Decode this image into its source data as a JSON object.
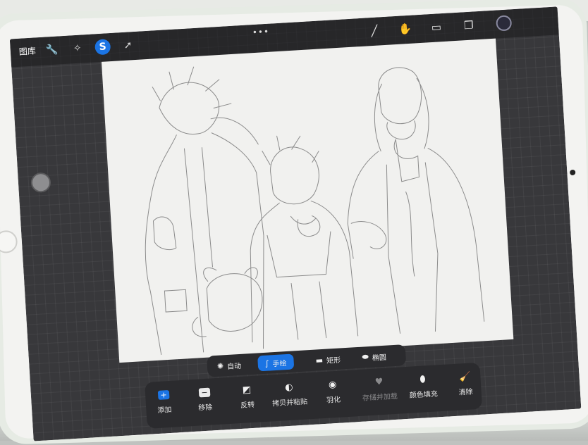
{
  "topbar": {
    "gallery_label": "图库",
    "icons": [
      "wrench-icon",
      "magic-wand-icon",
      "selection-icon",
      "transform-arrow-icon"
    ],
    "more_label": "•••",
    "tools": [
      "brush-icon",
      "smudge-icon",
      "eraser-icon",
      "layers-icon",
      "color-icon"
    ]
  },
  "selection_modes": [
    {
      "label": "自动",
      "icon": "sun-icon",
      "active": false
    },
    {
      "label": "手绘",
      "icon": "freehand-icon",
      "active": true
    },
    {
      "label": "矩形",
      "icon": "rectangle-icon",
      "active": false
    },
    {
      "label": "椭圆",
      "icon": "ellipse-icon",
      "active": false
    }
  ],
  "actions": [
    {
      "label": "添加",
      "icon": "add-icon"
    },
    {
      "label": "移除",
      "icon": "remove-icon"
    },
    {
      "label": "反转",
      "icon": "invert-icon"
    },
    {
      "label": "拷贝并粘贴",
      "icon": "copy-paste-icon"
    },
    {
      "label": "羽化",
      "icon": "feather-icon"
    },
    {
      "label": "存储并加载",
      "icon": "heart-icon",
      "disabled": true
    },
    {
      "label": "颜色填充",
      "icon": "fill-icon"
    },
    {
      "label": "清除",
      "icon": "broom-icon"
    }
  ],
  "colors": {
    "accent": "#1b74e4",
    "panel": "#2b2b2e",
    "screen_bg": "#38383b",
    "canvas": "#f1f1ef"
  }
}
